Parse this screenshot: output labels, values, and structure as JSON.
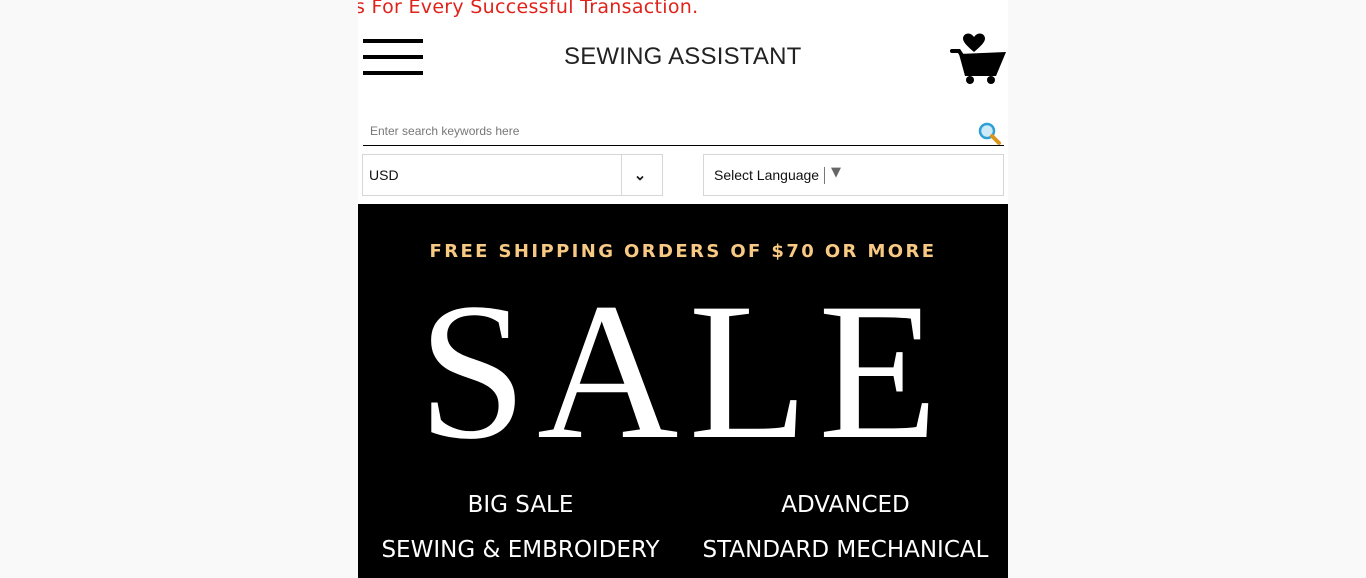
{
  "announcement": {
    "text": "s For Every Successful Transaction."
  },
  "header": {
    "logo_text": "SEWING ASSISTANT",
    "menu_icon": "hamburger-menu-icon",
    "cart_icon": "cart-with-heart-icon"
  },
  "search": {
    "placeholder": "Enter search keywords here",
    "value": "",
    "icon": "magnifier-icon"
  },
  "currency": {
    "selected": "USD",
    "icon": "chevron-down-icon"
  },
  "language": {
    "label": "Select Language",
    "arrow": "▼"
  },
  "banner": {
    "shipping_text": "FREE SHIPPING ORDERS OF $70 OR MORE",
    "sale_text": "SALE",
    "shipping_color": "#f7c983",
    "background": "#000000",
    "categories": [
      "BIG SALE",
      "ADVANCED",
      "SEWING & EMBROIDERY",
      "STANDARD MECHANICAL"
    ]
  },
  "colors": {
    "announcement_red": "#e0221b"
  }
}
